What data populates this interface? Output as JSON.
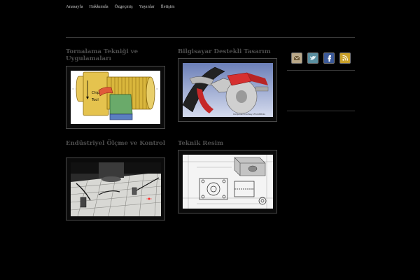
{
  "nav": {
    "items": [
      "Anasayfa",
      "Hakkımda",
      "Özgeçmiş",
      "Yayınlar",
      "İletişim"
    ]
  },
  "cards": [
    {
      "title": "Tornalama Tekniği ve Uygulamaları",
      "image": "lathe-turning-diagram",
      "labels": {
        "chip": "Chip",
        "tool": "Tool"
      }
    },
    {
      "title": "Bilgisayar Destekli Tasarım",
      "image": "cad-brake-assembly-render",
      "caption": "Component Courtesy of SolidWorks"
    },
    {
      "title": "Endüstriyel Ölçme ve Kontrol",
      "image": "laser-measurement-probe-photo"
    },
    {
      "title": "Teknik Resim",
      "image": "technical-drawing-blueprint"
    }
  ],
  "social": {
    "icons": [
      "contact-icon",
      "twitter-icon",
      "facebook-icon",
      "rss-icon"
    ],
    "colors": {
      "contact": "#b9a889",
      "twitter": "#5a8fa0",
      "facebook": "#3b5998",
      "rss": "#c9a12a"
    }
  },
  "colors": {
    "background": "#000000",
    "title": "#4d4d4d",
    "nav": "#d0d0d0",
    "rule": "#3a3a3a"
  }
}
